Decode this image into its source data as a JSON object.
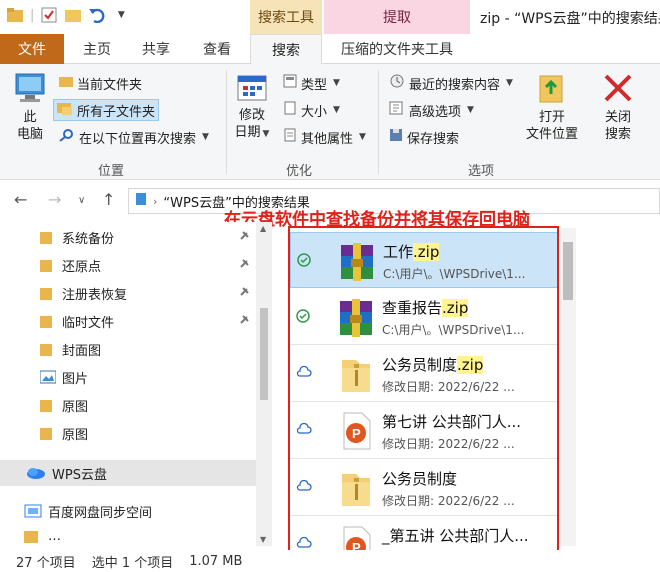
{
  "window": {
    "title": "zip - “WPS云盘”中的搜索结果",
    "context_search": "搜索工具",
    "context_extract": "提取"
  },
  "tabs": {
    "file": "文件",
    "home": "主页",
    "share": "共享",
    "view": "查看",
    "search": "搜索",
    "zip_tools": "压缩的文件夹工具"
  },
  "ribbon": {
    "location": {
      "this_pc_line1": "此",
      "this_pc_line2": "电脑",
      "current_folder": "当前文件夹",
      "all_subfolders": "所有子文件夹",
      "search_again": "在以下位置再次搜索",
      "label": "位置"
    },
    "refine": {
      "modified_line1": "修改",
      "modified_line2": "日期",
      "kind": "类型",
      "size": "大小",
      "other_props": "其他属性",
      "label": "优化"
    },
    "options": {
      "recent_searches": "最近的搜索内容",
      "advanced": "高级选项",
      "save_search": "保存搜索",
      "open_location_line1": "打开",
      "open_location_line2": "文件位置",
      "close_search_line1": "关闭",
      "close_search_line2": "搜索",
      "label": "选项"
    }
  },
  "address": {
    "path": "“WPS云盘”中的搜索结果"
  },
  "annotation": "在云盘软件中查找备份并将其保存回电脑",
  "nav": {
    "items": [
      {
        "label": "系统备份",
        "pinned": true
      },
      {
        "label": "还原点",
        "pinned": true
      },
      {
        "label": "注册表恢复",
        "pinned": true
      },
      {
        "label": "临时文件",
        "pinned": true
      },
      {
        "label": "封面图",
        "pinned": false
      },
      {
        "label": "图片",
        "pinned": false
      },
      {
        "label": "原图",
        "pinned": false
      },
      {
        "label": "原图",
        "pinned": false
      }
    ],
    "wps_cloud": "WPS云盘",
    "baidu_sync": "百度网盘同步空间",
    "partial": "…"
  },
  "files": [
    {
      "name": "工作",
      "ext": ".zip",
      "sub": "C:\\用户\\。\\WPSDrive\\1...",
      "sync": "synced",
      "type": "zip"
    },
    {
      "name": "查重报告",
      "ext": ".zip",
      "sub": "C:\\用户\\。\\WPSDrive\\1...",
      "sync": "synced",
      "type": "zip"
    },
    {
      "name": "公务员制度",
      "ext": ".zip",
      "sub": "修改日期: 2022/6/22 ...",
      "sync": "cloud",
      "type": "zipfolder"
    },
    {
      "name": "第七讲 公共部门人...",
      "ext": "",
      "sub": "修改日期: 2022/6/22 ...",
      "sync": "cloud",
      "type": "ppt"
    },
    {
      "name": "公务员制度",
      "ext": "",
      "sub": "修改日期: 2022/6/22 ...",
      "sync": "cloud",
      "type": "zipfolder"
    },
    {
      "name": "_第五讲 公共部门人...",
      "ext": "",
      "sub": "",
      "sync": "cloud",
      "type": "ppt"
    }
  ],
  "status": {
    "count": "27 个项目",
    "selected": "选中 1 个项目",
    "size": "1.07 MB"
  },
  "colors": {
    "accent": "#0078d7",
    "file_tab": "#c0691b",
    "annotation": "#e0201b",
    "highlight": "#fff48f"
  }
}
